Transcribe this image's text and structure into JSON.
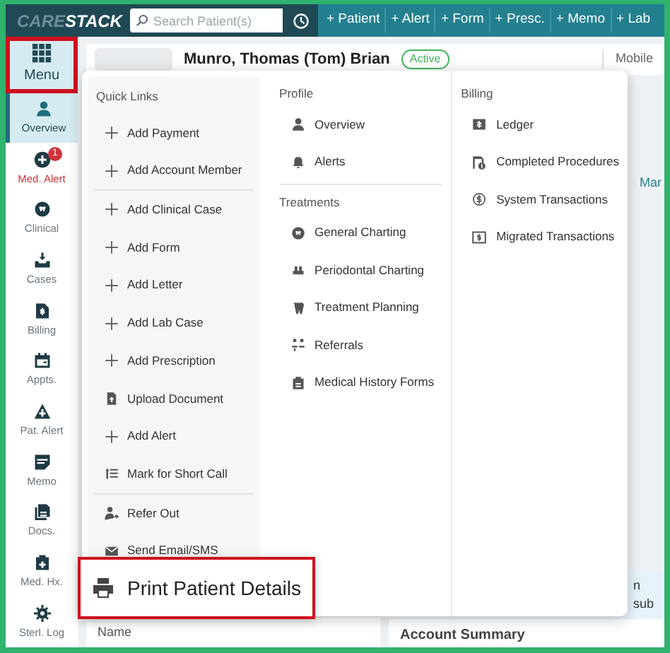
{
  "topbar": {
    "logo_left": "CARE",
    "logo_right": "STACK",
    "search": {
      "placeholder": "Search Patient(s)"
    },
    "actions": [
      "+ Patient",
      "+ Alert",
      "+ Form",
      "+ Presc.",
      "+ Memo",
      "+ Lab"
    ]
  },
  "sidebar": {
    "menu": {
      "label": "Menu",
      "highlighted": true
    },
    "items": [
      {
        "label": "Overview",
        "selected": true,
        "warning": false
      },
      {
        "label": "Med. Alert",
        "selected": false,
        "warning": true,
        "badge": "1"
      },
      {
        "label": "Clinical",
        "selected": false,
        "warning": false
      },
      {
        "label": "Cases",
        "selected": false,
        "warning": false
      },
      {
        "label": "Billing",
        "selected": false,
        "warning": false
      },
      {
        "label": "Appts.",
        "selected": false,
        "warning": false
      },
      {
        "label": "Pat. Alert",
        "selected": false,
        "warning": false
      },
      {
        "label": "Memo",
        "selected": false,
        "warning": false
      },
      {
        "label": "Docs.",
        "selected": false,
        "warning": false
      },
      {
        "label": "Med. Hx.",
        "selected": false,
        "warning": false
      },
      {
        "label": "Sterl. Log",
        "selected": false,
        "warning": false
      }
    ]
  },
  "patient": {
    "name": "Munro, Thomas (Tom) Brian",
    "status": "Active",
    "phone_label": "Mobile"
  },
  "background": {
    "link_fragment": "Mar",
    "note_fragment": "n sub",
    "section_title": "Account Summary",
    "column_header": "Name"
  },
  "menu_panel": {
    "quick_links": {
      "title": "Quick Links",
      "groups": [
        [
          "Add Payment",
          "Add Account Member"
        ],
        [
          "Add Clinical Case",
          "Add Form",
          "Add Letter",
          "Add Lab Case",
          "Add Prescription",
          "Upload Document",
          "Add Alert",
          "Mark for Short Call"
        ],
        [
          "Refer Out",
          "Send Email/SMS"
        ]
      ]
    },
    "sections": [
      {
        "title": "Profile",
        "items": [
          "Overview",
          "Alerts"
        ]
      },
      {
        "title": "Treatments",
        "items": [
          "General Charting",
          "Periodontal Charting",
          "Treatment Planning",
          "Referrals",
          "Medical History Forms"
        ]
      },
      {
        "title": "Billing",
        "items": [
          "Ledger",
          "Completed Procedures",
          "System Transactions",
          "Migrated Transactions"
        ]
      }
    ]
  },
  "callout": {
    "label": "Print Patient Details",
    "highlighted": true
  }
}
